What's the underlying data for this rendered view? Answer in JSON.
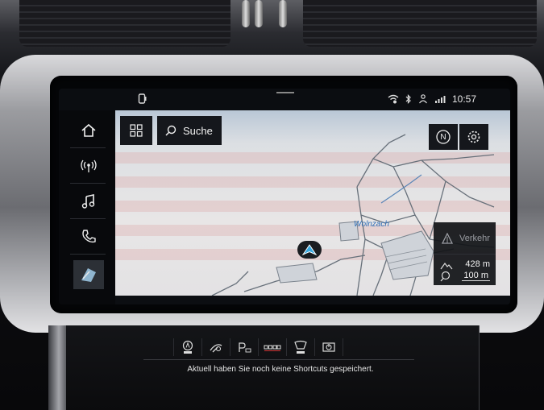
{
  "statusbar": {
    "time": "10:57",
    "icons": [
      "phone-status-icon",
      "wifi-hotspot-icon",
      "bluetooth-icon",
      "person-icon",
      "network-icon"
    ]
  },
  "sidebar": {
    "items": [
      {
        "name": "home",
        "icon": "home-icon"
      },
      {
        "name": "radio",
        "icon": "radio-antenna-icon"
      },
      {
        "name": "media",
        "icon": "music-note-icon"
      },
      {
        "name": "phone",
        "icon": "phone-icon"
      },
      {
        "name": "navigation",
        "icon": "map-icon"
      }
    ]
  },
  "map": {
    "search_label": "Suche",
    "compass_label": "N",
    "town_label": "Wolnzach",
    "traffic_label": "Verkehr",
    "altitude": "428 m",
    "scale": "100 m"
  },
  "shortcuts": {
    "icons": [
      "auto-hold-off-icon",
      "drive-select-icon",
      "park-assist-icon",
      "parking-sensor-icon",
      "lane-assist-off-icon",
      "start-stop-icon"
    ],
    "message": "Aktuell haben Sie noch keine Shortcuts gespeichert."
  },
  "colors": {
    "map_water_label": "#2f6fb7",
    "vehicle_arrow": "#3aa9e0",
    "ui_dark": "#15171c"
  }
}
